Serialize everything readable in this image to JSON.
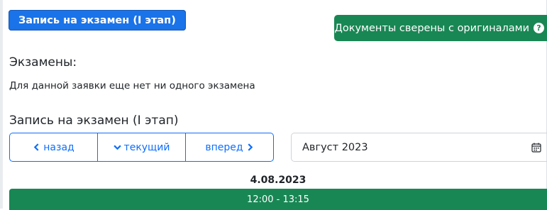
{
  "header": {
    "badge_label": "Запись на экзамен (I этап)",
    "docs_button_label": "Документы сверены с оригиналами",
    "help_glyph": "?"
  },
  "exams": {
    "title": "Экзамены:",
    "empty_text": "Для данной заявки еще нет ни одного экзамена"
  },
  "signup": {
    "title": "Запись на экзамен (I этап)",
    "nav": {
      "back_label": "назад",
      "current_label": "текущий",
      "forward_label": "вперед"
    },
    "month_value": "Август 2023",
    "date": "4.08.2023",
    "slots": [
      {
        "time": "12:00 - 13:15"
      }
    ]
  },
  "colors": {
    "primary": "#1a73e8",
    "success": "#198754",
    "link": "#0d6efd"
  },
  "icons": {
    "back": "chevron-left-icon",
    "current": "chevron-down-icon",
    "forward": "chevron-right-icon",
    "calendar": "calendar-icon",
    "help": "question-circle-icon"
  }
}
